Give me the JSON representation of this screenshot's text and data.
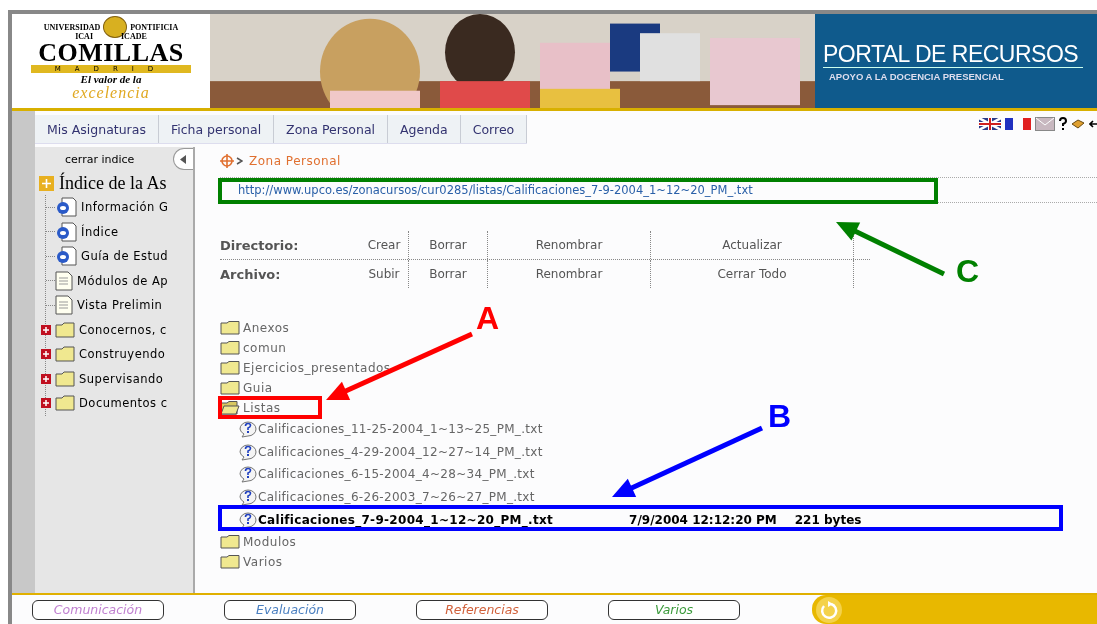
{
  "header": {
    "logo": {
      "top_left": "UNIVERSIDAD",
      "top_right": "PONTIFICIA",
      "left": "ICAI",
      "right": "ICADE",
      "name": "COMILLAS",
      "city": "MADRID",
      "motto_1": "El valor de la",
      "motto_2": "excelencia"
    },
    "title": "PORTAL DE RECURSOS",
    "subtitle": "APOYO A LA DOCENCIA PRESENCIAL"
  },
  "tabs": [
    {
      "label": "Mis Asignaturas",
      "selected": false
    },
    {
      "label": "Ficha personal",
      "selected": false
    },
    {
      "label": "Zona Personal",
      "selected": false
    },
    {
      "label": "Agenda",
      "selected": false
    },
    {
      "label": "Correo",
      "selected": false
    }
  ],
  "sidebar": {
    "close_label": "cerrar indice",
    "title": "Índice de la As",
    "items": [
      {
        "kind": "web",
        "label": "Información G"
      },
      {
        "kind": "web",
        "label": "Índice"
      },
      {
        "kind": "web",
        "label": "Guía de Estud"
      },
      {
        "kind": "doc",
        "label": "Módulos de Ap"
      },
      {
        "kind": "doc",
        "label": "Vista Prelimin"
      },
      {
        "kind": "folder",
        "label": "Conocernos, c"
      },
      {
        "kind": "folder",
        "label": "Construyendo"
      },
      {
        "kind": "folder",
        "label": "Supervisando"
      },
      {
        "kind": "folder",
        "label": "Documentos c"
      }
    ]
  },
  "breadcrumb": "Zona Personal",
  "url": "http://www.upco.es/zonacursos/cur0285/listas/Calificaciones_7-9-2004_1~12~20_PM_.txt",
  "actions": [
    {
      "label": "Directorio:",
      "items": [
        "Crear",
        "Borrar",
        "Renombrar",
        "Actualizar"
      ]
    },
    {
      "label": "Archivo:",
      "items": [
        "Subir",
        "Borrar",
        "Renombrar",
        "Cerrar Todo"
      ]
    }
  ],
  "files": [
    {
      "kind": "folder",
      "name": "Anexos",
      "expanded": false
    },
    {
      "kind": "folder",
      "name": "comun",
      "expanded": false
    },
    {
      "kind": "folder",
      "name": "Ejercicios_presentados",
      "expanded": false
    },
    {
      "kind": "folder",
      "name": "Guia",
      "expanded": false
    },
    {
      "kind": "folder",
      "name": "Listas",
      "expanded": true,
      "children": [
        {
          "kind": "file",
          "name": "Calificaciones_11-25-2004_1~13~25_PM_.txt",
          "selected": false
        },
        {
          "kind": "file",
          "name": "Calificaciones_4-29-2004_12~27~14_PM_.txt",
          "selected": false
        },
        {
          "kind": "file",
          "name": "Calificaciones_6-15-2004_4~28~34_PM_.txt",
          "selected": false
        },
        {
          "kind": "file",
          "name": "Calificaciones_6-26-2003_7~26~27_PM_.txt",
          "selected": false
        },
        {
          "kind": "file",
          "name": "Calificaciones_7-9-2004_1~12~20_PM_.txt",
          "selected": true,
          "date": "7/9/2004 12:12:20 PM",
          "size": "221 bytes"
        }
      ]
    },
    {
      "kind": "folder",
      "name": "Modulos",
      "expanded": false
    },
    {
      "kind": "folder",
      "name": "Varios",
      "expanded": false
    }
  ],
  "footer": [
    {
      "label": "Comunicación",
      "color": "#c080d0"
    },
    {
      "label": "Evaluación",
      "color": "#4a7fc0"
    },
    {
      "label": "Referencias",
      "color": "#d0603a"
    },
    {
      "label": "Varios",
      "color": "#3a9a3a"
    }
  ],
  "annotations": [
    {
      "label": "A",
      "color": "#ff0000"
    },
    {
      "label": "B",
      "color": "#0000ff"
    },
    {
      "label": "C",
      "color": "#008000"
    }
  ]
}
